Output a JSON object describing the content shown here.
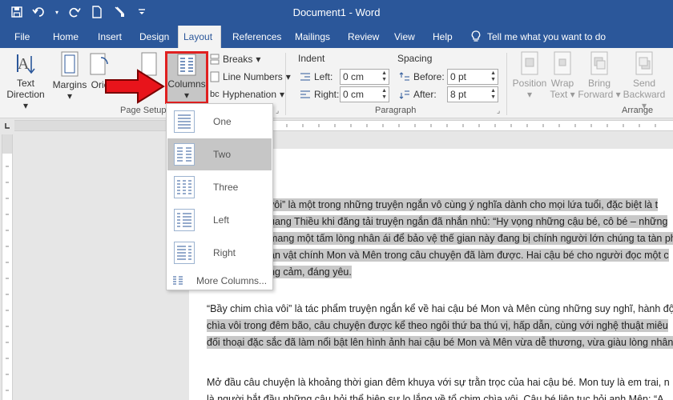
{
  "window": {
    "title": "Document1 - Word"
  },
  "tabs": [
    "File",
    "Home",
    "Insert",
    "Design",
    "Layout",
    "References",
    "Mailings",
    "Review",
    "View",
    "Help"
  ],
  "tell_me": "Tell me what you want to do",
  "ribbon": {
    "text_direction": [
      "Text",
      "Direction"
    ],
    "margins": "Margins",
    "orientation": "Orie",
    "columns": "Columns",
    "breaks": "Breaks",
    "line_numbers": "Line Numbers",
    "hyphenation": "Hyphenation",
    "page_setup_group": "Page Setup",
    "indent": {
      "heading": "Indent",
      "left_label": "Left:",
      "left_value": "0 cm",
      "right_label": "Right:",
      "right_value": "0 cm"
    },
    "spacing": {
      "heading": "Spacing",
      "before_label": "Before:",
      "before_value": "0 pt",
      "after_label": "After:",
      "after_value": "8 pt"
    },
    "paragraph_group": "Paragraph",
    "arrange": {
      "position": "Position",
      "wrap": [
        "Wrap",
        "Text"
      ],
      "bring": [
        "Bring",
        "Forward"
      ],
      "send": [
        "Send",
        "Backward"
      ],
      "group_label": "Arrange"
    }
  },
  "columns_menu": {
    "items": [
      "One",
      "Two",
      "Three",
      "Left",
      "Right"
    ],
    "selected": "Two",
    "more": "More Columns..."
  },
  "document": {
    "paragraph1": [
      "vôi” là một trong những truyện ngắn vô cùng ý nghĩa dành cho mọi lứa tuổi, đặc biệt là t",
      "uang Thiều khi đăng tải truyện ngắn đã nhắn nhủ: “Hy vọng những cậu bé, cô bé – những",
      "mang một tấm lòng nhân ái để bảo vệ thế gian này đang bị chính người lớn chúng ta tàn ph",
      "ân vật chính Mon và Mên trong câu chuyện đã làm được. Hai cậu bé cho người đọc một c",
      "ng cảm, đáng yêu."
    ],
    "paragraph2": [
      "“Bầy chim chìa vôi” là tác phẩm truyện ngắn kể về hai cậu bé Mon và Mên cùng những suy nghĩ, hành độ",
      "chìa vôi trong đêm bão, câu chuyện được kể theo ngôi thứ ba thú vị, hấp dẫn, cùng với nghệ thuật miêu",
      "đối thoại đặc sắc đã làm nổi bật lên hình ảnh hai cậu bé Mon và Mên vừa dễ thương, vừa giàu lòng nhân"
    ],
    "paragraph3": [
      "Mở đầu câu chuyện là khoảng thời gian đêm khuya với sự trằn trọc của hai cậu bé. Mon tuy là em trai, n",
      "là người bắt đầu những câu hỏi thể hiện sự lo lắng về tổ chim chìa vôi. Cậu bé liên tục hỏi anh Mên: “A"
    ]
  }
}
